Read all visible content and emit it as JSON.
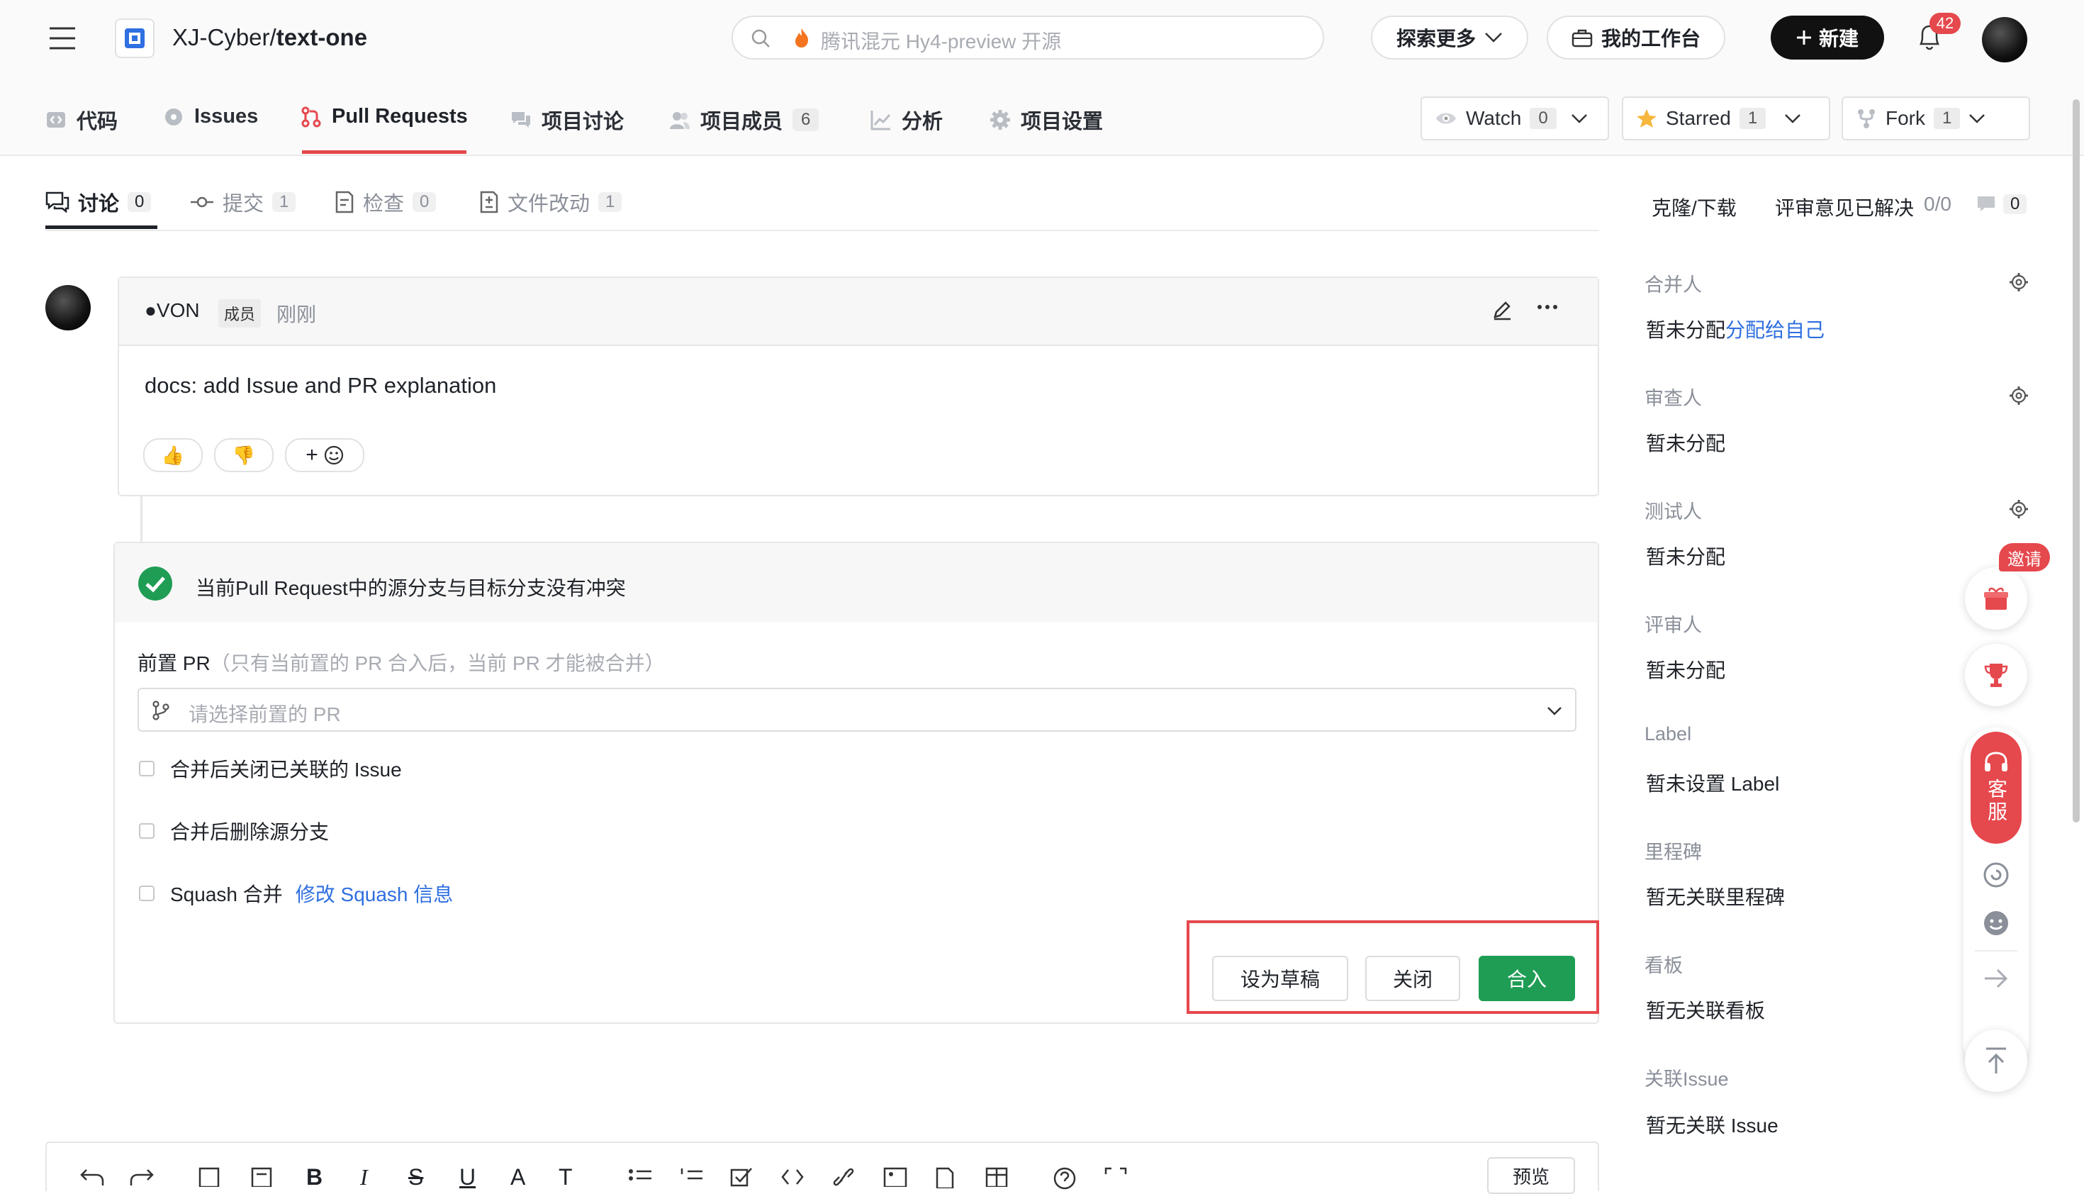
{
  "header": {
    "repo_owner": "XJ-Cyber/",
    "repo_name": "text-one",
    "search_placeholder": "腾讯混元 Hy4-preview 开源",
    "explore_label": "探索更多",
    "workspace_label": "我的工作台",
    "new_label": "新建",
    "notification_count": "42"
  },
  "repo_tabs": [
    {
      "label": "代码",
      "icon": "code-icon"
    },
    {
      "label": "Issues",
      "icon": "issue-icon"
    },
    {
      "label": "Pull Requests",
      "icon": "pull-request-icon",
      "active": true
    },
    {
      "label": "项目讨论",
      "icon": "discussion-icon"
    },
    {
      "label": "项目成员",
      "count": "6",
      "icon": "members-icon"
    },
    {
      "label": "分析",
      "icon": "chart-icon"
    },
    {
      "label": "项目设置",
      "icon": "gear-icon"
    }
  ],
  "repo_actions": {
    "watch_label": "Watch",
    "watch_count": "0",
    "star_label": "Starred",
    "star_count": "1",
    "fork_label": "Fork",
    "fork_count": "1"
  },
  "pr_tabs": [
    {
      "label": "讨论",
      "count": "0",
      "active": true
    },
    {
      "label": "提交",
      "count": "1"
    },
    {
      "label": "检查",
      "count": "0"
    },
    {
      "label": "文件改动",
      "count": "1"
    }
  ],
  "pr_meta": {
    "clone_label": "克隆/下载",
    "review_resolved_label": "评审意见已解决",
    "review_resolved_value": "0/0",
    "comment_count": "0"
  },
  "comment": {
    "author": "●VON",
    "badge": "成员",
    "time": "刚刚",
    "body": "docs: add Issue and PR explanation",
    "reactions": [
      "👍",
      "👎"
    ],
    "add_reaction": "+"
  },
  "merge": {
    "status_text": "当前Pull Request中的源分支与目标分支没有冲突",
    "prereq_label": "前置 PR",
    "prereq_hint": "（只有当前置的 PR 合入后，当前 PR 才能被合并）",
    "prereq_placeholder": "请选择前置的 PR",
    "options": [
      {
        "label": "合并后关闭已关联的 Issue"
      },
      {
        "label": "合并后删除源分支"
      },
      {
        "label": "Squash 合并",
        "link": "修改 Squash 信息"
      }
    ],
    "draft_label": "设为草稿",
    "close_label": "关闭",
    "merge_label": "合入"
  },
  "editor": {
    "preview_label": "预览"
  },
  "sidebar": {
    "sections": [
      {
        "title": "合并人",
        "value": "暂未分配",
        "link": "分配给自己",
        "gear": true
      },
      {
        "title": "审查人",
        "value": "暂未分配",
        "gear": true
      },
      {
        "title": "测试人",
        "value": "暂未分配",
        "gear": true
      },
      {
        "title": "评审人",
        "value": "暂未分配"
      },
      {
        "title": "Label",
        "value": "暂未设置 Label"
      },
      {
        "title": "里程碑",
        "value": "暂无关联里程碑"
      },
      {
        "title": "看板",
        "value": "暂无关联看板"
      },
      {
        "title": "关联Issue",
        "value": "暂无关联 Issue"
      }
    ]
  },
  "floating": {
    "invite_label": "邀请",
    "service_label": "客服"
  },
  "colors": {
    "accent_green": "#1f9d55",
    "link_blue": "#2f6fe0",
    "highlight_red": "#e5484d"
  }
}
